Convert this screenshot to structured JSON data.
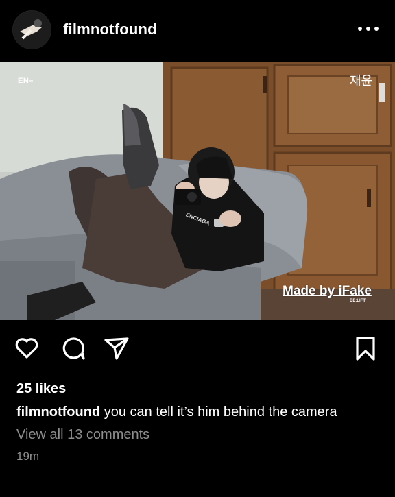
{
  "post": {
    "username": "filmnotfound",
    "likes": "25 likes",
    "caption_user": "filmnotfound",
    "caption_text": "you can tell it’s him behind the camera",
    "comments_link": "View all 13 comments",
    "time_ago": "19m"
  },
  "photo": {
    "logo_text": "EN–",
    "signature": "재윤",
    "shirt_text": "ENCIAGA",
    "watermark": "Made by iFake",
    "watermark_sub": "BE:LIFT"
  },
  "icons": {
    "more": "more-options-icon",
    "like": "heart-icon",
    "comment": "comment-icon",
    "share": "send-icon",
    "save": "bookmark-icon"
  }
}
